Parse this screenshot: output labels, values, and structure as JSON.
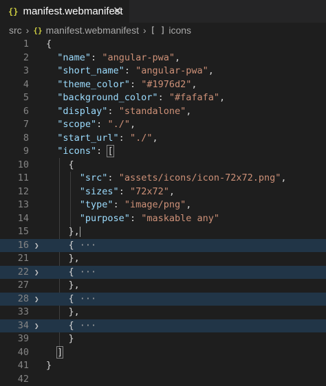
{
  "tab": {
    "icon": "{}",
    "title": "manifest.webmanifest",
    "close": "✕"
  },
  "breadcrumb": {
    "folder": "src",
    "file_icon": "{}",
    "file": "manifest.webmanifest",
    "symbol_icon": "[ ]",
    "symbol": "icons"
  },
  "lines": [
    {
      "num": "1",
      "parts": [
        [
          "p",
          "{"
        ]
      ]
    },
    {
      "num": "2",
      "parts": [
        [
          "p",
          "  "
        ],
        [
          "k",
          "\"name\""
        ],
        [
          "p",
          ": "
        ],
        [
          "s",
          "\"angular-pwa\""
        ],
        [
          "p",
          ","
        ]
      ]
    },
    {
      "num": "3",
      "parts": [
        [
          "p",
          "  "
        ],
        [
          "k",
          "\"short_name\""
        ],
        [
          "p",
          ": "
        ],
        [
          "s",
          "\"angular-pwa\""
        ],
        [
          "p",
          ","
        ]
      ]
    },
    {
      "num": "4",
      "parts": [
        [
          "p",
          "  "
        ],
        [
          "k",
          "\"theme_color\""
        ],
        [
          "p",
          ": "
        ],
        [
          "s",
          "\"#1976d2\""
        ],
        [
          "p",
          ","
        ]
      ]
    },
    {
      "num": "5",
      "parts": [
        [
          "p",
          "  "
        ],
        [
          "k",
          "\"background_color\""
        ],
        [
          "p",
          ": "
        ],
        [
          "s",
          "\"#fafafa\""
        ],
        [
          "p",
          ","
        ]
      ]
    },
    {
      "num": "6",
      "parts": [
        [
          "p",
          "  "
        ],
        [
          "k",
          "\"display\""
        ],
        [
          "p",
          ": "
        ],
        [
          "s",
          "\"standalone\""
        ],
        [
          "p",
          ","
        ]
      ]
    },
    {
      "num": "7",
      "parts": [
        [
          "p",
          "  "
        ],
        [
          "k",
          "\"scope\""
        ],
        [
          "p",
          ": "
        ],
        [
          "s",
          "\"./\""
        ],
        [
          "p",
          ","
        ]
      ]
    },
    {
      "num": "8",
      "parts": [
        [
          "p",
          "  "
        ],
        [
          "k",
          "\"start_url\""
        ],
        [
          "p",
          ": "
        ],
        [
          "s",
          "\"./\""
        ],
        [
          "p",
          ","
        ]
      ]
    },
    {
      "num": "9",
      "parts": [
        [
          "p",
          "  "
        ],
        [
          "k",
          "\"icons\""
        ],
        [
          "p",
          ": "
        ],
        [
          "b",
          "["
        ]
      ]
    },
    {
      "num": "10",
      "parts": [
        [
          "p",
          "    {"
        ]
      ]
    },
    {
      "num": "11",
      "parts": [
        [
          "p",
          "      "
        ],
        [
          "k",
          "\"src\""
        ],
        [
          "p",
          ": "
        ],
        [
          "s",
          "\"assets/icons/icon-72x72.png\""
        ],
        [
          "p",
          ","
        ]
      ]
    },
    {
      "num": "12",
      "parts": [
        [
          "p",
          "      "
        ],
        [
          "k",
          "\"sizes\""
        ],
        [
          "p",
          ": "
        ],
        [
          "s",
          "\"72x72\""
        ],
        [
          "p",
          ","
        ]
      ]
    },
    {
      "num": "13",
      "parts": [
        [
          "p",
          "      "
        ],
        [
          "k",
          "\"type\""
        ],
        [
          "p",
          ": "
        ],
        [
          "s",
          "\"image/png\""
        ],
        [
          "p",
          ","
        ]
      ]
    },
    {
      "num": "14",
      "parts": [
        [
          "p",
          "      "
        ],
        [
          "k",
          "\"purpose\""
        ],
        [
          "p",
          ": "
        ],
        [
          "s",
          "\"maskable any\""
        ]
      ]
    },
    {
      "num": "15",
      "parts": [
        [
          "p",
          "    },"
        ],
        [
          "c",
          ""
        ]
      ]
    },
    {
      "num": "16",
      "fold": true,
      "highlight": true,
      "parts": [
        [
          "p",
          "    { "
        ],
        [
          "e",
          "···"
        ]
      ]
    },
    {
      "num": "21",
      "parts": [
        [
          "p",
          "    },"
        ]
      ]
    },
    {
      "num": "22",
      "fold": true,
      "highlight": true,
      "parts": [
        [
          "p",
          "    { "
        ],
        [
          "e",
          "···"
        ]
      ]
    },
    {
      "num": "27",
      "parts": [
        [
          "p",
          "    },"
        ]
      ]
    },
    {
      "num": "28",
      "fold": true,
      "highlight": true,
      "parts": [
        [
          "p",
          "    { "
        ],
        [
          "e",
          "···"
        ]
      ]
    },
    {
      "num": "33",
      "parts": [
        [
          "p",
          "    },"
        ]
      ]
    },
    {
      "num": "34",
      "fold": true,
      "highlight": true,
      "parts": [
        [
          "p",
          "    { "
        ],
        [
          "e",
          "···"
        ]
      ]
    },
    {
      "num": "39",
      "parts": [
        [
          "p",
          "    }"
        ]
      ]
    },
    {
      "num": "40",
      "parts": [
        [
          "p",
          "  "
        ],
        [
          "b",
          "]"
        ]
      ]
    },
    {
      "num": "41",
      "parts": [
        [
          "p",
          "}"
        ]
      ]
    },
    {
      "num": "42",
      "parts": []
    }
  ],
  "colors": {
    "key": "#9cdcfe",
    "string": "#ce9178",
    "punct": "#d4d4d4",
    "highlight": "#213547",
    "json_icon": "#cbcb41"
  },
  "icons": {
    "fold": "chevron-right-icon",
    "tab": "json-file-icon",
    "symbol": "array-symbol-icon"
  }
}
